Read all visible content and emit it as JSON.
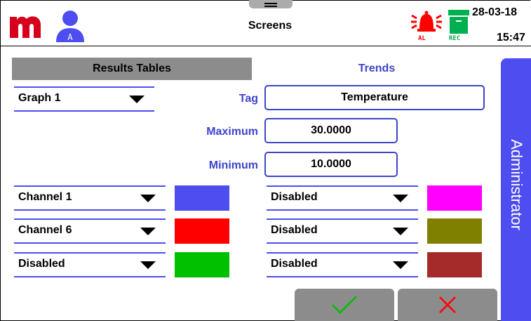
{
  "header": {
    "title": "Screens",
    "date": "28-03-18",
    "time": "15:47",
    "logo_icon": "m-logo-icon",
    "user_icon": "user-admin-icon",
    "alarm_icon": "alarm-bell-icon",
    "alarm_label": "AL",
    "record_icon": "record-box-icon",
    "record_label": "REC"
  },
  "tabs": {
    "results_tables": "Results Tables",
    "trends": "Trends"
  },
  "sidebar": {
    "label": "Administrator"
  },
  "graph_select": {
    "value": "Graph 1"
  },
  "tag": {
    "label": "Tag",
    "value": "Temperature"
  },
  "maximum": {
    "label": "Maximum",
    "value": "30.0000"
  },
  "minimum": {
    "label": "Minimum",
    "value": "10.0000"
  },
  "left_channels": [
    {
      "value": "Channel 1",
      "color": "#4d4df0"
    },
    {
      "value": "Channel 6",
      "color": "#ff0000"
    },
    {
      "value": "Disabled",
      "color": "#00c000"
    }
  ],
  "right_channels": [
    {
      "value": "Disabled",
      "color": "#ff00ff"
    },
    {
      "value": "Disabled",
      "color": "#808000"
    },
    {
      "value": "Disabled",
      "color": "#a52a2a"
    }
  ],
  "buttons": {
    "confirm_icon": "check-icon",
    "cancel_icon": "close-icon",
    "confirm_color": "#00c000",
    "cancel_color": "#ff0000"
  }
}
